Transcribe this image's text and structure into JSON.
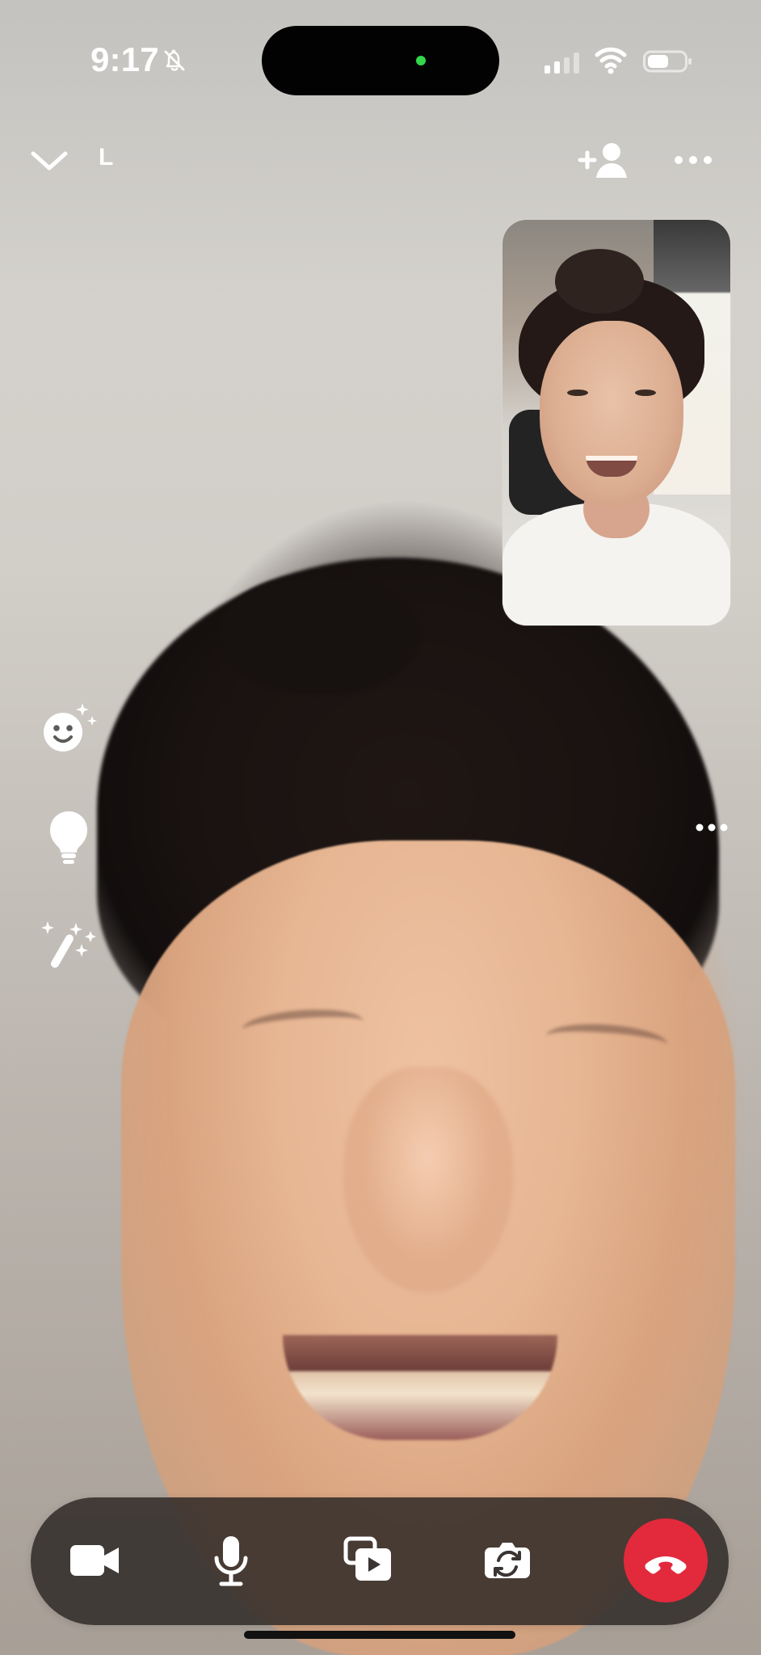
{
  "status_bar": {
    "time": "9:17",
    "icons": {
      "mute": "bell-slash-icon",
      "signal": "cellular-signal-icon",
      "wifi": "wifi-icon",
      "battery": "battery-icon"
    },
    "camera_indicator_color": "#32d74b"
  },
  "header": {
    "contact_label": "L",
    "icons": {
      "collapse": "chevron-down-icon",
      "add_participant": "add-person-icon",
      "more": "more-horizontal-icon"
    }
  },
  "sidebar_effects": {
    "icons": [
      "face-sparkle-icon",
      "lightbulb-icon",
      "magic-wand-icon"
    ]
  },
  "participant_actions": {
    "more_icon": "more-horizontal-icon"
  },
  "bottom_controls": {
    "icons": [
      "video-camera-icon",
      "microphone-icon",
      "share-screen-icon",
      "camera-flip-icon",
      "end-call-icon"
    ],
    "end_call_color": "#e22a3c"
  }
}
